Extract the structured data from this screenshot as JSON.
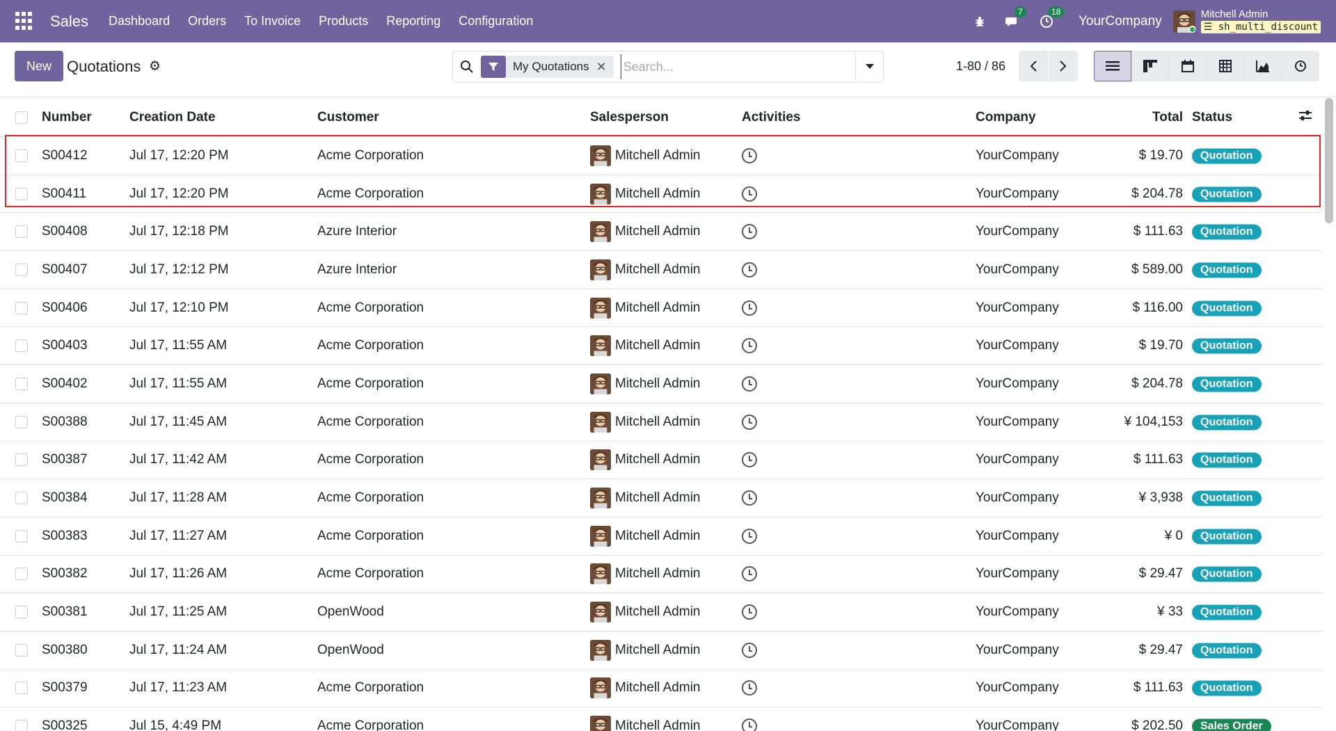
{
  "navbar": {
    "brand": "Sales",
    "menu": [
      "Dashboard",
      "Orders",
      "To Invoice",
      "Products",
      "Reporting",
      "Configuration"
    ],
    "chat_count": "7",
    "activity_count": "18",
    "company": "YourCompany",
    "user_name": "Mitchell Admin",
    "db_name": "sh_multi_discount",
    "db_icon": "database-icon"
  },
  "control_panel": {
    "new_label": "New",
    "title": "Quotations",
    "facet_label": "My Quotations",
    "search_placeholder": "Search...",
    "pager": "1-80 / 86"
  },
  "list": {
    "headers": {
      "number": "Number",
      "date": "Creation Date",
      "customer": "Customer",
      "salesperson": "Salesperson",
      "activities": "Activities",
      "company": "Company",
      "total": "Total",
      "status": "Status"
    },
    "rows": [
      {
        "number": "S00412",
        "date": "Jul 17, 12:20 PM",
        "customer": "Acme Corporation",
        "salesperson": "Mitchell Admin",
        "company": "YourCompany",
        "total": "$ 19.70",
        "status": "Quotation"
      },
      {
        "number": "S00411",
        "date": "Jul 17, 12:20 PM",
        "customer": "Acme Corporation",
        "salesperson": "Mitchell Admin",
        "company": "YourCompany",
        "total": "$ 204.78",
        "status": "Quotation"
      },
      {
        "number": "S00408",
        "date": "Jul 17, 12:18 PM",
        "customer": "Azure Interior",
        "salesperson": "Mitchell Admin",
        "company": "YourCompany",
        "total": "$ 111.63",
        "status": "Quotation"
      },
      {
        "number": "S00407",
        "date": "Jul 17, 12:12 PM",
        "customer": "Azure Interior",
        "salesperson": "Mitchell Admin",
        "company": "YourCompany",
        "total": "$ 589.00",
        "status": "Quotation"
      },
      {
        "number": "S00406",
        "date": "Jul 17, 12:10 PM",
        "customer": "Acme Corporation",
        "salesperson": "Mitchell Admin",
        "company": "YourCompany",
        "total": "$ 116.00",
        "status": "Quotation"
      },
      {
        "number": "S00403",
        "date": "Jul 17, 11:55 AM",
        "customer": "Acme Corporation",
        "salesperson": "Mitchell Admin",
        "company": "YourCompany",
        "total": "$ 19.70",
        "status": "Quotation"
      },
      {
        "number": "S00402",
        "date": "Jul 17, 11:55 AM",
        "customer": "Acme Corporation",
        "salesperson": "Mitchell Admin",
        "company": "YourCompany",
        "total": "$ 204.78",
        "status": "Quotation"
      },
      {
        "number": "S00388",
        "date": "Jul 17, 11:45 AM",
        "customer": "Acme Corporation",
        "salesperson": "Mitchell Admin",
        "company": "YourCompany",
        "total": "¥ 104,153",
        "status": "Quotation"
      },
      {
        "number": "S00387",
        "date": "Jul 17, 11:42 AM",
        "customer": "Acme Corporation",
        "salesperson": "Mitchell Admin",
        "company": "YourCompany",
        "total": "$ 111.63",
        "status": "Quotation"
      },
      {
        "number": "S00384",
        "date": "Jul 17, 11:28 AM",
        "customer": "Acme Corporation",
        "salesperson": "Mitchell Admin",
        "company": "YourCompany",
        "total": "¥ 3,938",
        "status": "Quotation"
      },
      {
        "number": "S00383",
        "date": "Jul 17, 11:27 AM",
        "customer": "Acme Corporation",
        "salesperson": "Mitchell Admin",
        "company": "YourCompany",
        "total": "¥ 0",
        "status": "Quotation"
      },
      {
        "number": "S00382",
        "date": "Jul 17, 11:26 AM",
        "customer": "Acme Corporation",
        "salesperson": "Mitchell Admin",
        "company": "YourCompany",
        "total": "$ 29.47",
        "status": "Quotation"
      },
      {
        "number": "S00381",
        "date": "Jul 17, 11:25 AM",
        "customer": "OpenWood",
        "salesperson": "Mitchell Admin",
        "company": "YourCompany",
        "total": "¥ 33",
        "status": "Quotation"
      },
      {
        "number": "S00380",
        "date": "Jul 17, 11:24 AM",
        "customer": "OpenWood",
        "salesperson": "Mitchell Admin",
        "company": "YourCompany",
        "total": "$ 29.47",
        "status": "Quotation"
      },
      {
        "number": "S00379",
        "date": "Jul 17, 11:23 AM",
        "customer": "Acme Corporation",
        "salesperson": "Mitchell Admin",
        "company": "YourCompany",
        "total": "$ 111.63",
        "status": "Quotation"
      },
      {
        "number": "S00325",
        "date": "Jul 15, 4:49 PM",
        "customer": "Acme Corporation",
        "salesperson": "Mitchell Admin",
        "company": "YourCompany",
        "total": "$ 202.50",
        "status": "Sales Order"
      }
    ]
  },
  "colors": {
    "brand": "#71639e",
    "quotation_badge": "#17a2b8",
    "sales_order_badge": "#198754",
    "highlight": "#e02424"
  }
}
